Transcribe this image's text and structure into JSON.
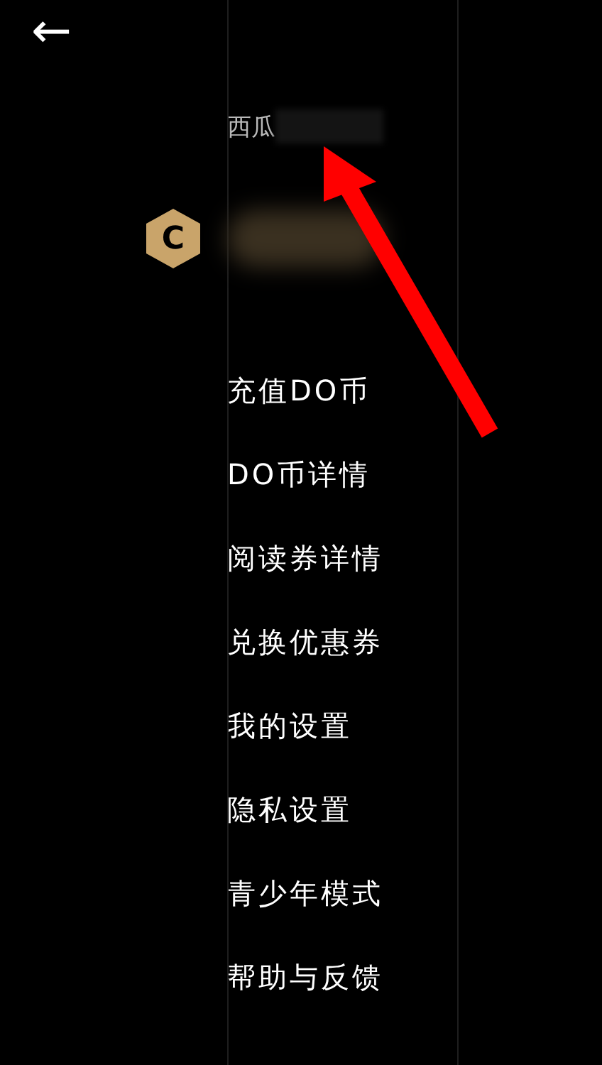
{
  "header": {
    "back": "←"
  },
  "profile": {
    "name": "西瓜",
    "coin_icon": "C"
  },
  "menu_items": [
    {
      "label": "充值DO币"
    },
    {
      "label": "DO币详情"
    },
    {
      "label": "阅读券详情"
    },
    {
      "label": "兑换优惠券"
    },
    {
      "label": "我的设置"
    },
    {
      "label": "隐私设置"
    },
    {
      "label": "青少年模式"
    },
    {
      "label": "帮助与反馈"
    }
  ]
}
